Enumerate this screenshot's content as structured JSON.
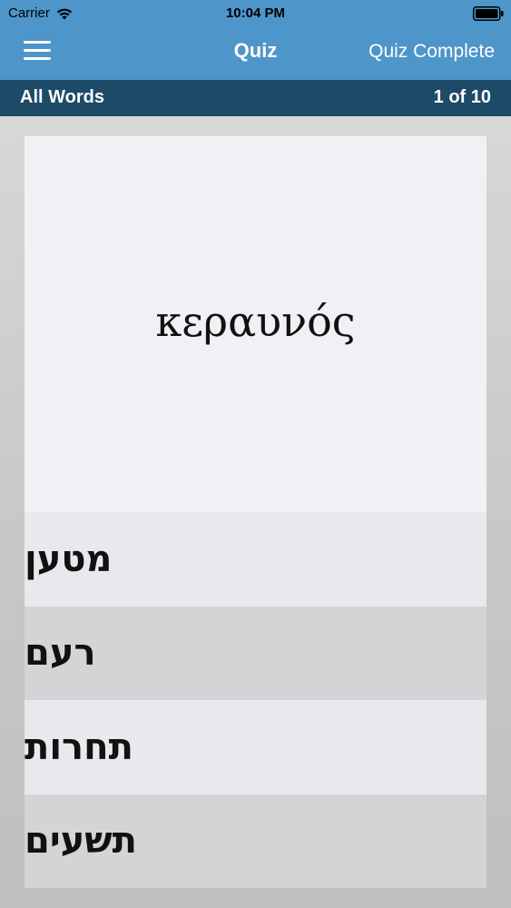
{
  "status_bar": {
    "carrier": "Carrier",
    "time": "10:04 PM"
  },
  "nav": {
    "title": "Quiz",
    "action_label": "Quiz Complete"
  },
  "sub_bar": {
    "list_name": "All Words",
    "progress": "1 of 10"
  },
  "quiz": {
    "prompt_word": "κεραυνός",
    "answers": [
      {
        "label": "מטען"
      },
      {
        "label": "רעם"
      },
      {
        "label": "תחרות"
      },
      {
        "label": "תשעים"
      }
    ]
  },
  "colors": {
    "nav_blue": "#4e95c9",
    "sub_bar_navy": "#1d4a67",
    "card_light": "#eff1f4",
    "answer_light": "#e7e9ec",
    "answer_dark": "#d3d4d6"
  },
  "icons": {
    "wifi": "wifi-icon",
    "battery": "battery-icon",
    "menu": "hamburger-menu-icon"
  }
}
